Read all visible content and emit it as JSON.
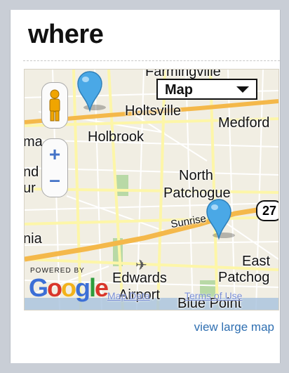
{
  "widget": {
    "title": "where",
    "large_map_label": "view large map"
  },
  "map": {
    "type_selector": "Map",
    "zoom_in": "+",
    "zoom_out": "–",
    "places": {
      "farmingville": "Farmingville",
      "holtsville": "Holtsville",
      "holbrook": "Holbrook",
      "medford": "Medford",
      "north_patchogue_1": "North",
      "north_patchogue_2": "Patchogue",
      "sunrise": "Sunrise Hwy",
      "east_patchog_1": "East",
      "east_patchog_2": "Patchog",
      "edwards_1": "Edwards",
      "edwards_2": "Airport",
      "blue_point": "Blue Point",
      "left_ma": "ma",
      "left_nia": "nia",
      "left_nd": "nd",
      "left_ur": "ur",
      "route": "27"
    },
    "powered_by": "POWERED BY",
    "logo": [
      "G",
      "o",
      "o",
      "g",
      "l",
      "e"
    ],
    "map_data_link": "Map Data",
    "terms_link": "Terms of Use",
    "colors": {
      "highway": "#f4b84a",
      "road": "#fdf6a8",
      "street": "#ffffff",
      "pin": "#4aa8e6",
      "park": "#b8d9a6"
    }
  }
}
